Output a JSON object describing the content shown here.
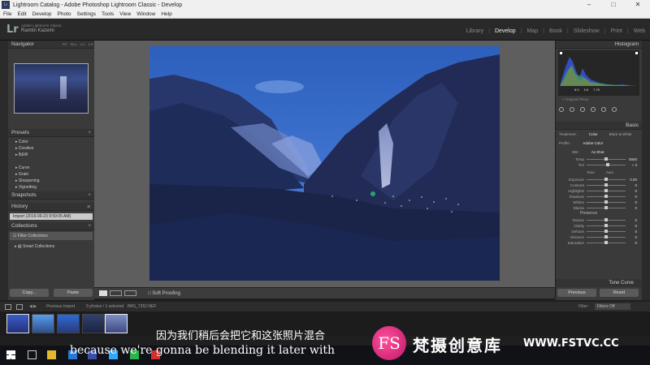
{
  "window": {
    "title": "Lightroom Catalog - Adobe Photoshop Lightroom Classic - Develop",
    "icon": "Lr"
  },
  "menu": [
    "File",
    "Edit",
    "Develop",
    "Photo",
    "Settings",
    "Tools",
    "View",
    "Window",
    "Help"
  ],
  "identity": {
    "logo": "Lr",
    "product": "Adobe Lightroom Classic",
    "user": "Ramtin Kazemi"
  },
  "modules": [
    "Library",
    "Develop",
    "Map",
    "Book",
    "Slideshow",
    "Print",
    "Web"
  ],
  "active_module": "Develop",
  "left": {
    "navigator": {
      "title": "Navigator",
      "zoom_options": [
        "FIT",
        "FILL",
        "1:1",
        "1:3"
      ]
    },
    "presets": {
      "title": "Presets",
      "items": [
        "Color",
        "Creative",
        "B&W",
        "Curve",
        "Grain",
        "Sharpening",
        "Vignetting"
      ]
    },
    "snapshots": {
      "title": "Snapshots"
    },
    "history": {
      "title": "History",
      "items": [
        "Import (2019-09-23 9:59:05 AM)"
      ]
    },
    "collections": {
      "title": "Collections",
      "items": [
        "Filter Collections",
        "Smart Collections"
      ]
    },
    "copy_label": "Copy...",
    "paste_label": "Paste"
  },
  "toolbar": {
    "soft_proofing": "Soft Proofing"
  },
  "right": {
    "histogram": {
      "title": "Histogram",
      "values": [
        "6.5",
        "1/4",
        "7.78"
      ],
      "original_photo": "Original Photo"
    },
    "basic": {
      "title": "Basic",
      "treatment_label": "Treatment :",
      "treatment_options": [
        "Color",
        "Black & White"
      ],
      "profile_label": "Profile :",
      "profile_value": "Adobe Color",
      "wb_label": "WB :",
      "wb_value": "As Shot",
      "sliders_wb": [
        {
          "label": "Temp",
          "value": "5550"
        },
        {
          "label": "Tint",
          "value": "+ 3"
        }
      ],
      "tone_label": "Tone",
      "auto_label": "Auto",
      "sliders_tone": [
        {
          "label": "Exposure",
          "value": "0.00"
        },
        {
          "label": "Contrast",
          "value": "0"
        },
        {
          "label": "Highlights",
          "value": "0"
        },
        {
          "label": "Shadows",
          "value": "0"
        },
        {
          "label": "Whites",
          "value": "0"
        },
        {
          "label": "Blacks",
          "value": "0"
        }
      ],
      "presence_label": "Presence",
      "sliders_presence": [
        {
          "label": "Texture",
          "value": "0"
        },
        {
          "label": "Clarity",
          "value": "0"
        },
        {
          "label": "Dehaze",
          "value": "0"
        },
        {
          "label": "Vibrance",
          "value": "0"
        },
        {
          "label": "Saturation",
          "value": "0"
        }
      ]
    },
    "tone_curve": "Tone Curve",
    "previous_label": "Previous",
    "reset_label": "Reset"
  },
  "filmstrip_bar": {
    "source": "Previous Import",
    "count": "5 photos / 1 selected",
    "filename": "/IMG_7352.NEF",
    "filter_label": "Filter :",
    "filter_value": "Filters Off"
  },
  "subtitles": {
    "cn": "因为我们稍后会把它和这张照片混合",
    "en": "because we're gonna be blending it later with"
  },
  "watermark": {
    "logo": "FS",
    "name": "梵摄创意库",
    "url": "WWW.FSTVC.CC"
  }
}
